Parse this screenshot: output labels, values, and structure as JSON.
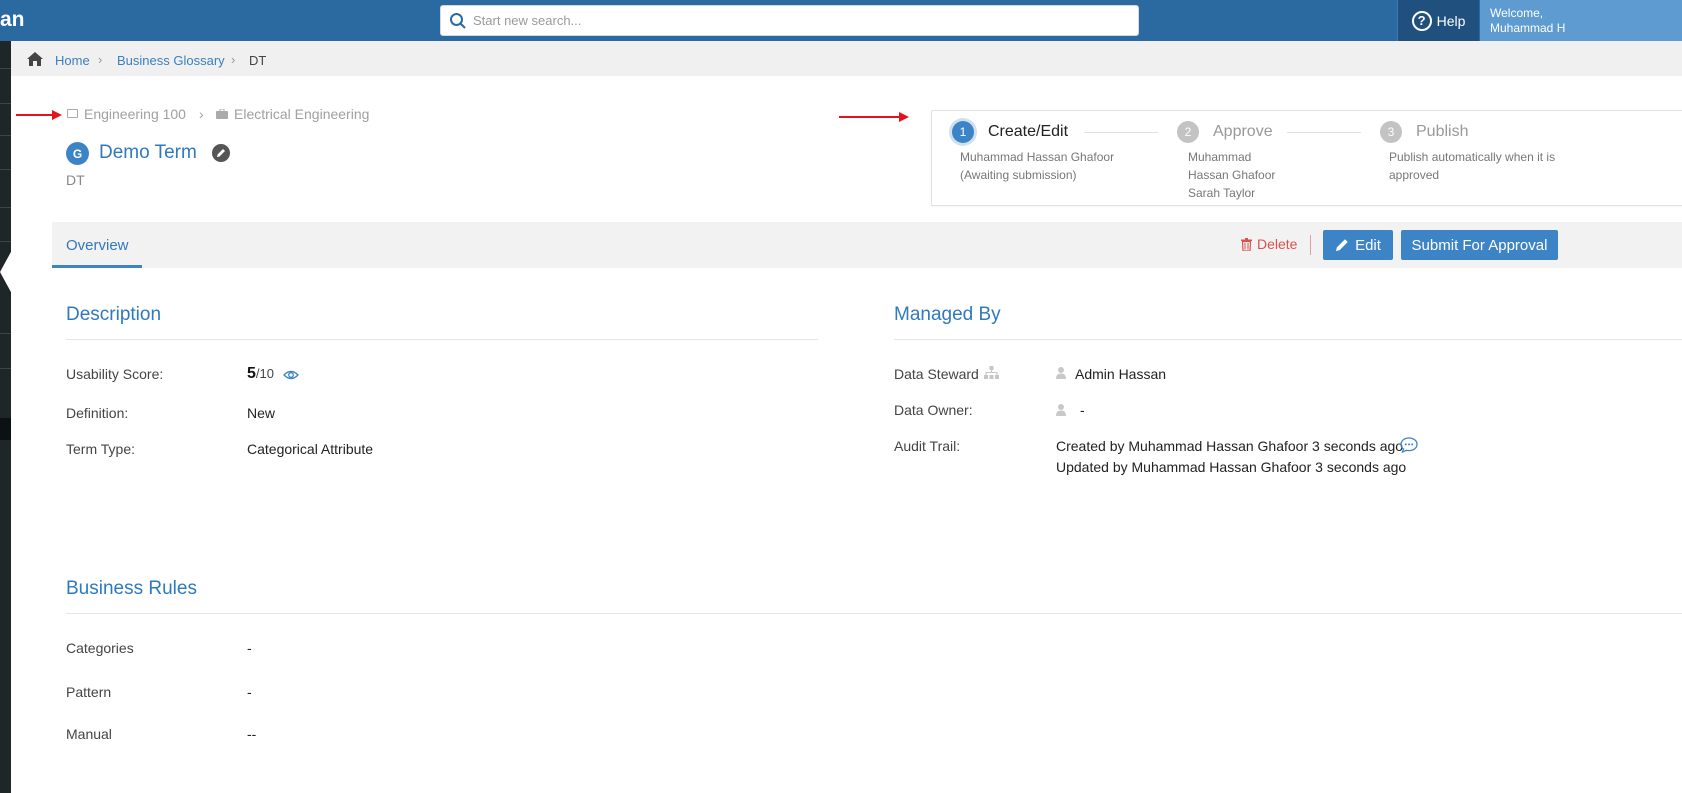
{
  "header": {
    "brand_fragment": "an",
    "search_placeholder": "Start new search...",
    "help_label": "Help",
    "welcome_line1": "Welcome,",
    "welcome_line2": "Muhammad H"
  },
  "breadcrumb": {
    "items": [
      "Home",
      "Business Glossary",
      "DT"
    ]
  },
  "hierarchy": {
    "parent": "Engineering 100",
    "child": "Electrical Engineering"
  },
  "term": {
    "badge": "G",
    "name": "Demo Term",
    "abbreviation": "DT"
  },
  "workflow": {
    "steps": [
      {
        "num": "1",
        "title": "Create/Edit",
        "desc1": "Muhammad Hassan Ghafoor",
        "desc2": "(Awaiting submission)",
        "desc3": ""
      },
      {
        "num": "2",
        "title": "Approve",
        "desc1": "Muhammad",
        "desc2": "Hassan Ghafoor",
        "desc3": "Sarah Taylor"
      },
      {
        "num": "3",
        "title": "Publish",
        "desc1": "Publish automatically when it is",
        "desc2": "approved",
        "desc3": ""
      }
    ]
  },
  "tabs": {
    "overview": "Overview",
    "delete": "Delete",
    "edit": "Edit",
    "submit": "Submit For Approval"
  },
  "description": {
    "title": "Description",
    "usability_label": "Usability Score:",
    "usability_score": "5",
    "usability_max": "/10",
    "definition_label": "Definition:",
    "definition_value": "New",
    "term_type_label": "Term Type:",
    "term_type_value": "Categorical Attribute"
  },
  "managed_by": {
    "title": "Managed By",
    "steward_label": "Data Steward",
    "steward_value": "Admin Hassan",
    "owner_label": "Data Owner:",
    "owner_value": "-",
    "audit_label": "Audit Trail:",
    "audit_created": "Created by Muhammad Hassan Ghafoor 3 seconds ago",
    "audit_updated": "Updated by Muhammad Hassan Ghafoor 3 seconds ago"
  },
  "business_rules": {
    "title": "Business Rules",
    "categories_label": "Categories",
    "categories_value": "-",
    "pattern_label": "Pattern",
    "pattern_value": "-",
    "manual_label": "Manual",
    "manual_value": "--"
  },
  "colors": {
    "topbar": "#2b6aa1",
    "accent": "#3d84c6",
    "danger": "#d9534f",
    "annotation_arrow": "#e3131b"
  }
}
